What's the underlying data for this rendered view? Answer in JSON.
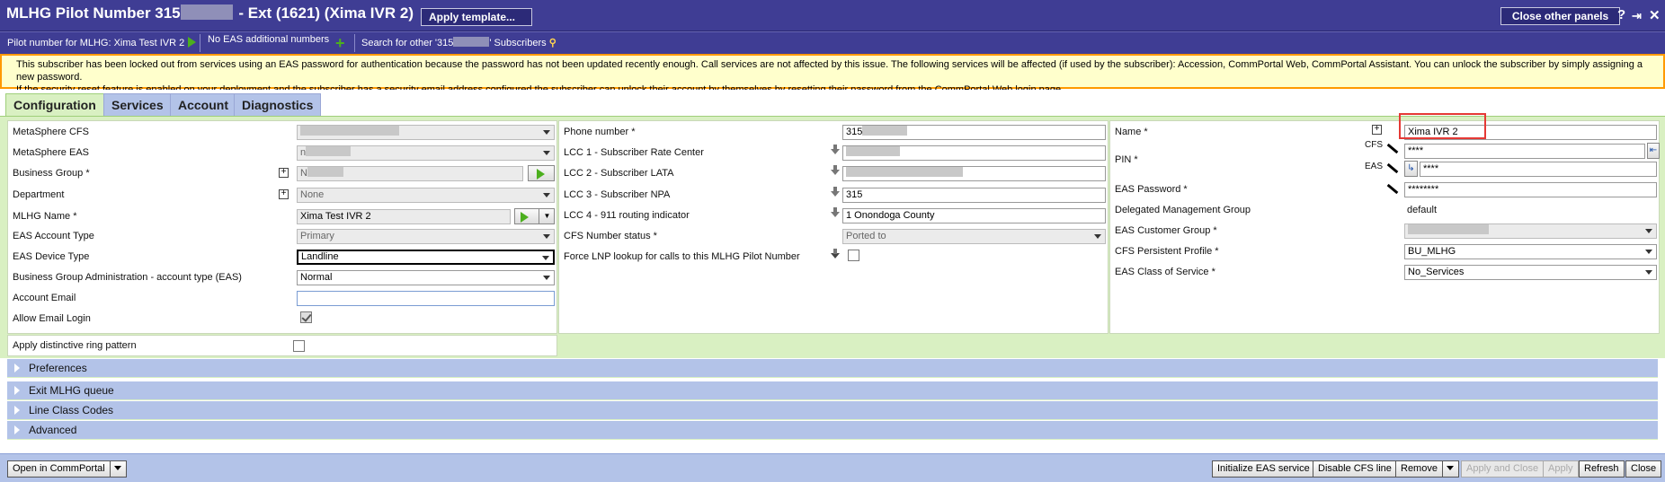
{
  "window": {
    "title_prefix": "MLHG Pilot Number 315",
    "title_suffix": " - Ext (1621) (Xima IVR 2)",
    "apply_template_label": "Apply template...",
    "close_other_panels_label": "Close other panels",
    "help_icon": "?",
    "pin_icon": "⇥",
    "close_icon": "✕"
  },
  "subbar": {
    "pilot_number_link": "Pilot number for MLHG: Xima Test IVR 2",
    "eas_numbers": "No EAS additional numbers",
    "search_prefix": "Search for other '315",
    "search_suffix": "' Subscribers"
  },
  "warning": {
    "line1": "This subscriber has been locked out from services using an EAS password for authentication because the password has not been updated recently enough. Call services are not affected by this issue. The following services will be affected (if used by the subscriber): Accession, CommPortal Web, CommPortal Assistant. You can unlock the subscriber by simply assigning a new password.",
    "line2": "If the security reset feature is enabled on your deployment and the subscriber has a security email address configured the subscriber can unlock their account by themselves by resetting their password from the CommPortal Web login page."
  },
  "tabs": [
    {
      "label": "Configuration"
    },
    {
      "label": "Services"
    },
    {
      "label": "Account"
    },
    {
      "label": "Diagnostics"
    }
  ],
  "col1": {
    "metasphere_cfs_label": "MetaSphere CFS",
    "metasphere_eas_label": "MetaSphere EAS",
    "metasphere_eas_value": "n",
    "business_group_label": "Business Group *",
    "business_group_value": "N",
    "department_label": "Department",
    "department_value": "None",
    "mlhg_name_label": "MLHG Name *",
    "mlhg_name_value": "Xima Test IVR 2",
    "eas_account_type_label": "EAS Account Type",
    "eas_account_type_value": "Primary",
    "eas_device_type_label": "EAS Device Type",
    "eas_device_type_value": "Landline",
    "bg_admin_label": "Business Group Administration - account type (EAS)",
    "bg_admin_value": "Normal",
    "account_email_label": "Account Email",
    "account_email_value": "",
    "allow_email_login_label": "Allow Email Login",
    "distinctive_ring_label": "Apply distinctive ring pattern"
  },
  "col2": {
    "phone_number_label": "Phone number *",
    "phone_number_value": "315",
    "lcc1_label": "LCC 1 - Subscriber Rate Center",
    "lcc2_label": "LCC 2 - Subscriber LATA",
    "lcc3_label": "LCC 3 - Subscriber NPA",
    "lcc3_value": "315",
    "lcc4_label": "LCC 4 - 911 routing indicator",
    "lcc4_value": "1 Onondoga County",
    "cfs_number_status_label": "CFS Number status *",
    "cfs_number_status_value": "Ported to",
    "force_lnp_label": "Force LNP lookup for calls to this MLHG Pilot Number"
  },
  "col3": {
    "name_label": "Name *",
    "name_value": "Xima IVR 2",
    "pin_label": "PIN *",
    "cfs_tag": "CFS",
    "eas_tag": "EAS",
    "pin_cfs_value": "****",
    "pin_eas_value": "****",
    "eas_password_label": "EAS Password *",
    "eas_password_value": "********",
    "dmg_label": "Delegated Management Group",
    "dmg_value": "default",
    "eas_customer_group_label": "EAS Customer Group *",
    "cfs_persistent_profile_label": "CFS Persistent Profile *",
    "cfs_persistent_profile_value": "BU_MLHG",
    "eas_class_of_service_label": "EAS Class of Service *",
    "eas_class_of_service_value": "No_Services"
  },
  "sections": [
    {
      "label": "Preferences"
    },
    {
      "label": "Exit MLHG queue"
    },
    {
      "label": "Line Class Codes"
    },
    {
      "label": "Advanced"
    }
  ],
  "footer": {
    "open_commportal": "Open in CommPortal",
    "initialize_eas": "Initialize EAS service",
    "disable_cfs_line": "Disable CFS line",
    "remove": "Remove",
    "apply_and_close": "Apply and Close",
    "apply": "Apply",
    "refresh": "Refresh",
    "close": "Close"
  }
}
